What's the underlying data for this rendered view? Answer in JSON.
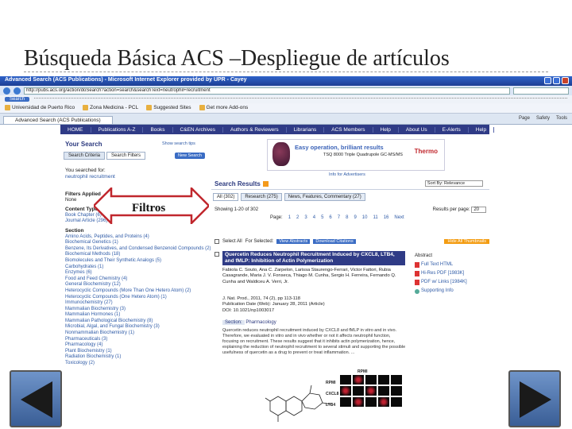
{
  "slide": {
    "title": "Búsqueda  Básica ACS –Despliegue de artículos",
    "callout_label": "Filtros"
  },
  "browser": {
    "window_title": "Advanced Search (ACS Publications) - Microsoft Internet Explorer provided by UPR - Cayey",
    "url": "http://pubs.acs.org/action/doSearch?action=search&searchText=neutrophil+recruitment",
    "search_button": "Search",
    "favorites": [
      "Universidad de Puerto Rico",
      "Zona Medicina - PCL",
      "Suggested Sites",
      "Get more Add-ons"
    ],
    "tab_title": "Advanced Search (ACS Publications)",
    "tools": [
      "Page",
      "Safety",
      "Tools"
    ]
  },
  "site_nav": [
    "HOME",
    "Publications A-Z",
    "Books",
    "C&EN Archives",
    "Authors & Reviewers",
    "Librarians",
    "ACS Members",
    "Help",
    "About Us",
    "E-Alerts",
    "Help"
  ],
  "your_search": {
    "title": "Your Search",
    "link": "Show search tips",
    "tabs": [
      "Search Criteria",
      "Search Filters"
    ],
    "active_tab": 1,
    "new_search": "New Search",
    "searched_for_label": "You searched for:",
    "searched_term": "neutrophil recruitment",
    "filters_applied_label": "Filters Applied",
    "filters_applied_value": "None"
  },
  "filters": {
    "content_type_title": "Content Type",
    "content_types": [
      "Book Chapter (6)",
      "Journal Article (296)"
    ],
    "section_title": "Section",
    "sections": [
      "Amino Acids, Peptides, and Proteins (4)",
      "Biochemical Genetics (1)",
      "Benzene, Its Derivatives, and Condensed Benzenoid Compounds (2)",
      "Biochemical Methods (18)",
      "Biomolecules and Their Synthetic Analogs (5)",
      "Carbohydrates (1)",
      "Enzymes (6)",
      "Food and Feed Chemistry (4)",
      "General Biochemistry (12)",
      "Heterocyclic Compounds (More Than One Hetero Atom) (2)",
      "Heterocyclic Compounds (One Hetero Atom) (1)",
      "Immunochemistry (27)",
      "Mammalian Biochemistry (3)",
      "Mammalian Hormones (1)",
      "Mammalian Pathological Biochemistry (8)",
      "Microbial, Algal, and Fungal Biochemistry (3)",
      "Nonmammalian Biochemistry (1)",
      "Pharmaceuticals (3)",
      "Pharmacology (4)",
      "Plant Biochemistry (1)",
      "Radiation Biochemistry (1)",
      "Toxicology (2)"
    ]
  },
  "ad": {
    "headline": "Easy operation, brilliant results",
    "sub": "TSQ 8000 Triple Quadrupole GC-MS/MS",
    "brand": "Thermo",
    "note": "Info for Advertisers"
  },
  "results": {
    "title": "Search Results",
    "sort": "Sort By: Relevance",
    "tabs": [
      "All (302)",
      "Research (275)",
      "News, Features, Commentary (27)"
    ],
    "active_tab": 0,
    "showing": "Showing 1-20 of 302",
    "per_page_label": "Results per page:",
    "per_page_value": "20",
    "page_label": "Page:",
    "pages": [
      "1",
      "2",
      "3",
      "4",
      "5",
      "6",
      "7",
      "8",
      "9",
      "10",
      "11",
      "16",
      "Next"
    ],
    "select_all": "Select All",
    "for_selected": "For Selected:",
    "view_abstracts": "View Abstracts",
    "download_citations": "Download Citations",
    "hide_thumbnails": "Hide All Thumbnails"
  },
  "article": {
    "title": "Quercetin Reduces Neutrophil Recruitment Induced by CXCL8, LTB4, and fMLP: Inhibition of Actin Polymerization",
    "authors": "Fabiola C. Souto, Ana C. Zarpelon, Larissa Staurengo-Ferrari, Victor Fattori, Rubia Casagrande, Maria J. V. Fonseca, Thiago M. Cunha, Sergio H. Ferreira, Fernando Q. Cunha and Waldiceu A. Verri, Jr.",
    "journal": "J. Nat. Prod., 2011, 74 (2), pp 113-118",
    "pub_date": "Publication Date (Web): January 28, 2011 (Article)",
    "doi": "DOI: 10.1021/np1003017",
    "section_label": "Section:",
    "section_value": "Pharmacology",
    "abstract": "Quercetin reduces neutrophil recruitment induced by CXCL8 and fMLP in vitro and in vivo. Therefore, we evaluated in vitro and in vivo whether or not it affects neutrophil function, focusing on recruitment. These results suggest that it inhibits actin polymerization, hence, explaining the reduction of neutrophil recruitment to several stimuli and supporting the possible usefulness of quercetin as a drug to prevent or treat inflammation. ...",
    "abstract_label": "Abstract",
    "links": [
      "Full Text HTML",
      "Hi-Res PDF [1983K]",
      "PDF w/ Links [1984K]",
      "Supporting Info"
    ],
    "panel_header": "RPMI",
    "panel_rows": [
      "RPMI",
      "CXCL8",
      "LTB4"
    ]
  }
}
